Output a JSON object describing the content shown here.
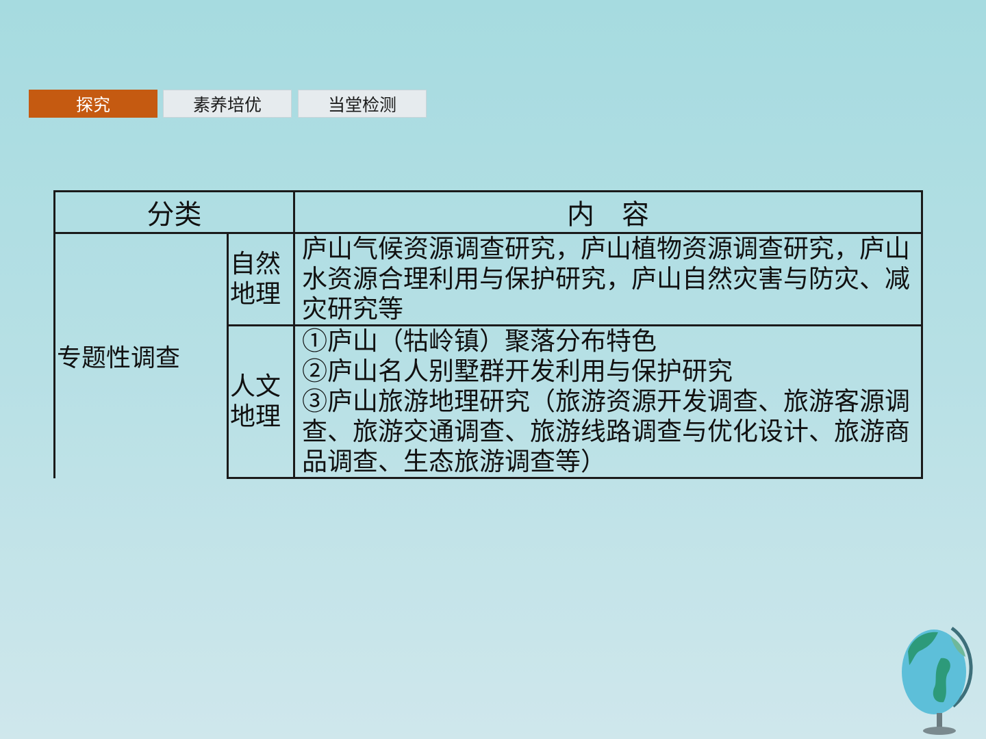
{
  "tabs": [
    {
      "label": "探究",
      "active": true
    },
    {
      "label": "素养培优",
      "active": false
    },
    {
      "label": "当堂检测",
      "active": false
    }
  ],
  "table": {
    "header_category": "分类",
    "header_content": "内　容",
    "category": "专题性调查",
    "rows": [
      {
        "sub": "自然地理",
        "content": "庐山气候资源调查研究，庐山植物资源调查研究，庐山水资源合理利用与保护研究，庐山自然灾害与防灾、减灾研究等"
      },
      {
        "sub": "人文地理",
        "items": [
          "①庐山（牯岭镇）聚落分布特色",
          "②庐山名人别墅群开发利用与保护研究",
          "③庐山旅游地理研究（旅游资源开发调查、旅游客源调查、旅游交通调查、旅游线路调查与优化设计、旅游商品调查、生态旅游调查等）"
        ]
      }
    ]
  },
  "colors": {
    "active_tab": "#c55a11",
    "inactive_tab": "#e6ebee",
    "background": "#a6dbe0"
  },
  "icons": [
    "globe-icon"
  ]
}
